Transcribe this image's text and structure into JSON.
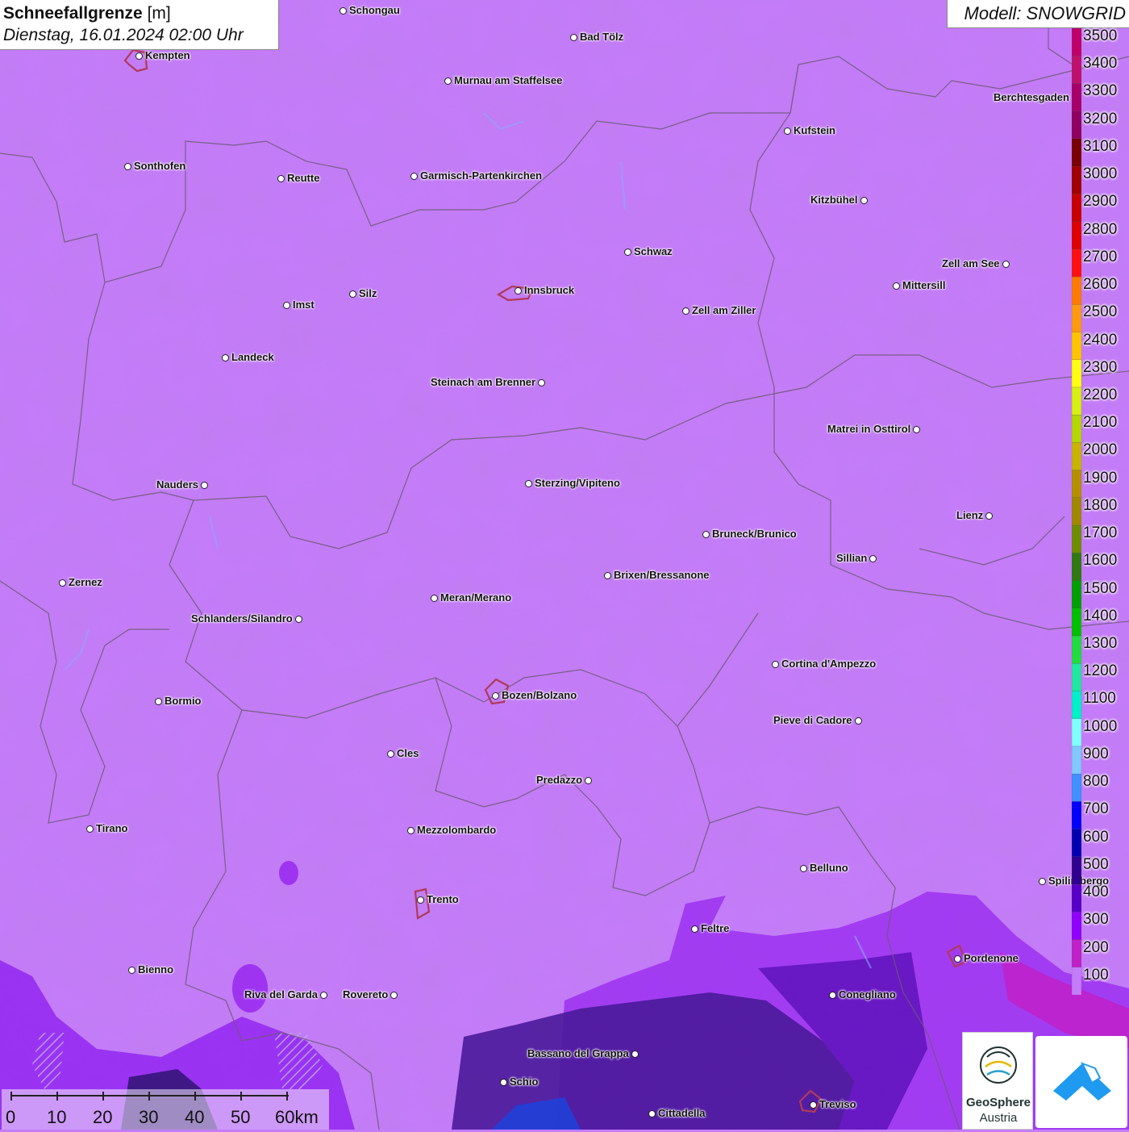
{
  "header": {
    "title_bold": "Schneefallgrenze",
    "title_unit": " [m]",
    "subtitle": "Dienstag, 16.01.2024 02:00 Uhr"
  },
  "model": {
    "label": "Modell: SNOWGRID"
  },
  "legend": {
    "labels": [
      "3500",
      "3400",
      "3300",
      "3200",
      "3100",
      "3000",
      "2900",
      "2800",
      "2700",
      "2600",
      "2500",
      "2400",
      "2300",
      "2200",
      "2100",
      "2000",
      "1900",
      "1800",
      "1700",
      "1600",
      "1500",
      "1400",
      "1300",
      "1200",
      "1100",
      "1000",
      "900",
      "800",
      "700",
      "600",
      "500",
      "400",
      "300",
      "200",
      "100"
    ],
    "colors": [
      "#c0006a",
      "#c0106e",
      "#a8006a",
      "#900060",
      "#7a0000",
      "#a00000",
      "#c80000",
      "#e00000",
      "#ff1010",
      "#ff7a00",
      "#ff9a10",
      "#ffc400",
      "#ffff10",
      "#d8f010",
      "#b4d800",
      "#c8b400",
      "#b49000",
      "#a08800",
      "#6e8e00",
      "#2e7a10",
      "#00a000",
      "#00c000",
      "#20dc40",
      "#20e8a0",
      "#00f0c8",
      "#80ffff",
      "#80c8ff",
      "#4090ff",
      "#0000ff",
      "#0000b0",
      "#300090",
      "#5800c8",
      "#9000ff",
      "#c020c8",
      "#c47cf9"
    ]
  },
  "cities": [
    {
      "name": "Schongau",
      "label_side": "right"
    },
    {
      "name": "Kempten",
      "label_side": "right"
    },
    {
      "name": "Bad Tölz",
      "label_side": "right"
    },
    {
      "name": "Murnau am Staffelsee",
      "label_side": "right"
    },
    {
      "name": "Berchtesgaden",
      "label_side": "left"
    },
    {
      "name": "Kufstein",
      "label_side": "right"
    },
    {
      "name": "Sonthofen",
      "label_side": "right"
    },
    {
      "name": "Reutte",
      "label_side": "right"
    },
    {
      "name": "Garmisch-Partenkirchen",
      "label_side": "right"
    },
    {
      "name": "Kitzbühel",
      "label_side": "left"
    },
    {
      "name": "Schwaz",
      "label_side": "right"
    },
    {
      "name": "Zell am See",
      "label_side": "left"
    },
    {
      "name": "Mittersill",
      "label_side": "right"
    },
    {
      "name": "Innsbruck",
      "label_side": "right"
    },
    {
      "name": "Silz",
      "label_side": "right"
    },
    {
      "name": "Imst",
      "label_side": "right"
    },
    {
      "name": "Zell am Ziller",
      "label_side": "right"
    },
    {
      "name": "Landeck",
      "label_side": "right"
    },
    {
      "name": "Steinach am Brenner",
      "label_side": "left"
    },
    {
      "name": "Matrei in Osttirol",
      "label_side": "left"
    },
    {
      "name": "Nauders",
      "label_side": "left"
    },
    {
      "name": "Sterzing/Vipiteno",
      "label_side": "right"
    },
    {
      "name": "Lienz",
      "label_side": "left"
    },
    {
      "name": "Bruneck/Brunico",
      "label_side": "right"
    },
    {
      "name": "Sillian",
      "label_side": "left"
    },
    {
      "name": "Zernez",
      "label_side": "right"
    },
    {
      "name": "Brixen/Bressanone",
      "label_side": "right"
    },
    {
      "name": "Meran/Merano",
      "label_side": "right"
    },
    {
      "name": "Schlanders/Silandro",
      "label_side": "left"
    },
    {
      "name": "Cortina d'Ampezzo",
      "label_side": "right"
    },
    {
      "name": "Bozen/Bolzano",
      "label_side": "right"
    },
    {
      "name": "Bormio",
      "label_side": "right"
    },
    {
      "name": "Pieve di Cadore",
      "label_side": "left"
    },
    {
      "name": "Cles",
      "label_side": "right"
    },
    {
      "name": "Predazzo",
      "label_side": "left"
    },
    {
      "name": "Tirano",
      "label_side": "right"
    },
    {
      "name": "Mezzolombardo",
      "label_side": "right"
    },
    {
      "name": "Belluno",
      "label_side": "right"
    },
    {
      "name": "Spilimbergo",
      "label_side": "right"
    },
    {
      "name": "Trento",
      "label_side": "right"
    },
    {
      "name": "Feltre",
      "label_side": "right"
    },
    {
      "name": "Pordenone",
      "label_side": "right"
    },
    {
      "name": "Bienno",
      "label_side": "right"
    },
    {
      "name": "Riva del Garda",
      "label_side": "left"
    },
    {
      "name": "Rovereto",
      "label_side": "left"
    },
    {
      "name": "Conegliano",
      "label_side": "right"
    },
    {
      "name": "Bassano del Grappa",
      "label_side": "left"
    },
    {
      "name": "Schio",
      "label_side": "right"
    },
    {
      "name": "Treviso",
      "label_side": "right"
    },
    {
      "name": "Cittadella",
      "label_side": "right"
    }
  ],
  "scale": {
    "ticks": [
      "0",
      "10",
      "20",
      "30",
      "40",
      "50",
      "60km"
    ]
  },
  "logos": {
    "geosphere_line1": "GeoSphere",
    "geosphere_line2": "Austria"
  }
}
